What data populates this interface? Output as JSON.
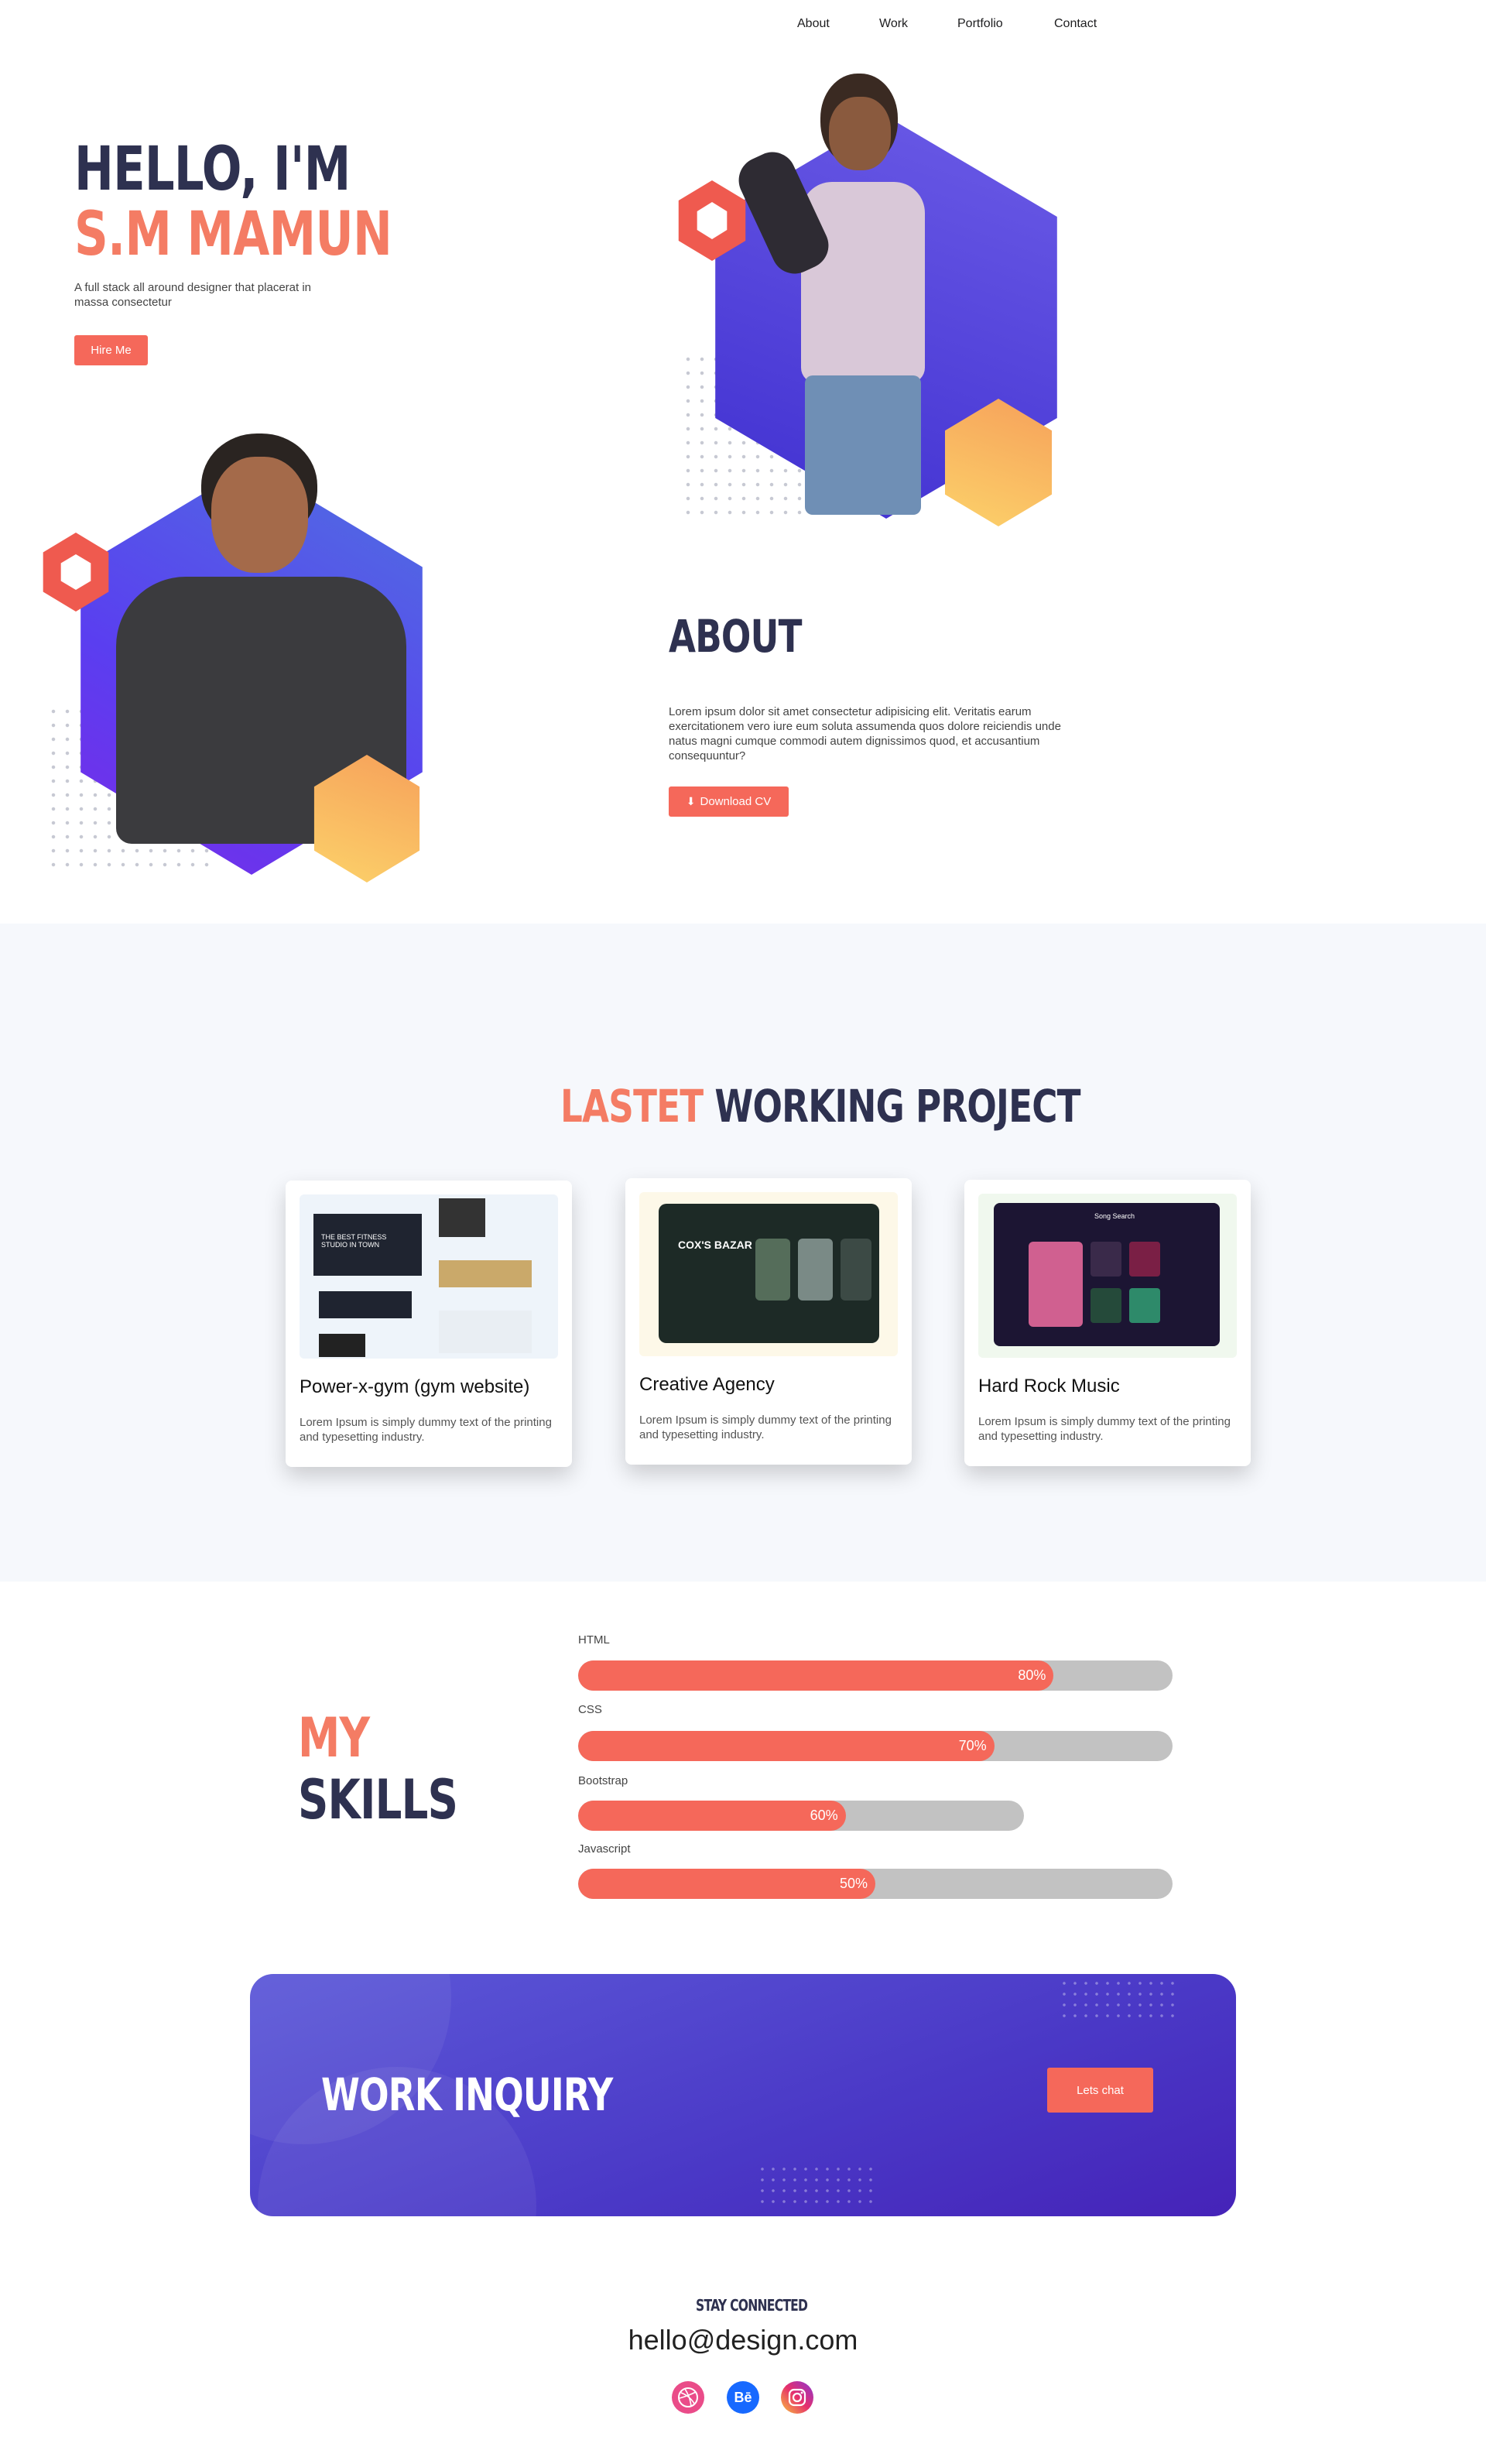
{
  "nav": {
    "items": [
      "About",
      "Work",
      "Portfolio",
      "Contact"
    ]
  },
  "hero": {
    "greeting": "HELLO, I'M",
    "name": "S.M MAMUN",
    "subtitle": "A full stack all around designer that placerat in massa consectetur",
    "cta": "Hire Me"
  },
  "about": {
    "title": "ABOUT",
    "text": "Lorem ipsum dolor sit amet consectetur adipisicing elit. Veritatis earum exercitationem vero iure eum soluta assumenda quos dolore reiciendis unde natus magni cumque commodi autem dignissimos quod, et accusantium consequuntur?",
    "download": "Download CV",
    "download_icon": "download-icon"
  },
  "projects": {
    "title_accent": "LASTET",
    "title_rest": "WORKING PROJECT",
    "items": [
      {
        "title": "Power-x-gym (gym website)",
        "desc": "Lorem Ipsum is simply dummy text of the printing and typesetting industry.",
        "thumb_caption": "THE BEST FITNESS STUDIO IN TOWN"
      },
      {
        "title": "Creative Agency",
        "desc": "Lorem Ipsum is simply dummy text of the printing and typesetting industry.",
        "thumb_caption": "COX'S BAZAR"
      },
      {
        "title": "Hard Rock Music",
        "desc": "Lorem Ipsum is simply dummy text of the printing and typesetting industry.",
        "thumb_caption": "Song Search"
      }
    ]
  },
  "skills": {
    "title_accent": "MY",
    "title_rest": "SKILLS",
    "items": [
      {
        "name": "HTML",
        "value": 80,
        "label": "80%"
      },
      {
        "name": "CSS",
        "value": 70,
        "label": "70%"
      },
      {
        "name": "Bootstrap",
        "value": 60,
        "label": "60%"
      },
      {
        "name": "Javascript",
        "value": 50,
        "label": "50%"
      }
    ]
  },
  "inquiry": {
    "title": "WORK INQUIRY",
    "cta": "Lets chat"
  },
  "footer": {
    "kicker": "STAY CONNECTED",
    "email": "hello@design.com",
    "socials": [
      "dribbble-icon",
      "behance-icon",
      "instagram-icon"
    ]
  },
  "colors": {
    "accent": "#f5685a",
    "navy": "#2e3150",
    "purple": "#4a38c6",
    "orange": "#f47c64"
  }
}
